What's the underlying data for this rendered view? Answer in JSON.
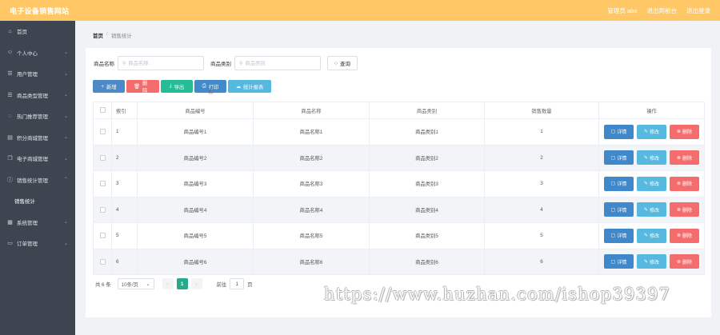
{
  "topbar": {
    "site_title": "电子设备销售网站",
    "user_label": "管理员 abo",
    "exit_label": "退出到前台",
    "logout_label": "退出登录"
  },
  "sidebar": {
    "items": [
      {
        "label": "首页",
        "icon": "home-icon",
        "expandable": false
      },
      {
        "label": "个人中心",
        "icon": "user-icon",
        "expandable": true
      },
      {
        "label": "用户管理",
        "icon": "list-icon",
        "expandable": true
      },
      {
        "label": "商品类型管理",
        "icon": "list-icon",
        "expandable": true
      },
      {
        "label": "热门推荐管理",
        "icon": "hot-icon",
        "expandable": true
      },
      {
        "label": "积分商城管理",
        "icon": "store-icon",
        "expandable": true
      },
      {
        "label": "电子商城管理",
        "icon": "copy-icon",
        "expandable": true
      },
      {
        "label": "销售统计管理",
        "icon": "info-icon",
        "expandable": true
      },
      {
        "label": "销售统计",
        "icon": "",
        "expandable": false,
        "sub": true
      },
      {
        "label": "系统管理",
        "icon": "chart-icon",
        "expandable": true
      },
      {
        "label": "订单管理",
        "icon": "order-icon",
        "expandable": true
      }
    ]
  },
  "breadcrumb": {
    "home": "首页",
    "separator": "/",
    "current": "销售统计"
  },
  "search": {
    "name_label": "商品名称",
    "name_placeholder": "商品名称",
    "type_label": "商品类别",
    "type_placeholder": "商品类别",
    "query_label": "查询"
  },
  "toolbar": {
    "add_label": "新增",
    "delete_label": "删除",
    "export_label": "导出",
    "print_label": "打印",
    "stats_label": "统计报表"
  },
  "table": {
    "headers": [
      "",
      "索引",
      "商品编号",
      "商品名称",
      "商品类别",
      "销售数量",
      "操作"
    ],
    "rows": [
      {
        "index": "1",
        "code": "商品编号1",
        "name": "商品名称1",
        "type": "商品类别1",
        "qty": "1"
      },
      {
        "index": "2",
        "code": "商品编号2",
        "name": "商品名称2",
        "type": "商品类别2",
        "qty": "2"
      },
      {
        "index": "3",
        "code": "商品编号3",
        "name": "商品名称3",
        "type": "商品类别3",
        "qty": "3"
      },
      {
        "index": "4",
        "code": "商品编号4",
        "name": "商品名称4",
        "type": "商品类别4",
        "qty": "4"
      },
      {
        "index": "5",
        "code": "商品编号5",
        "name": "商品名称5",
        "type": "商品类别5",
        "qty": "5"
      },
      {
        "index": "6",
        "code": "商品编号6",
        "name": "商品名称6",
        "type": "商品类别6",
        "qty": "6"
      }
    ],
    "row_actions": {
      "detail_label": "详情",
      "edit_label": "修改",
      "delete_label": "删除"
    }
  },
  "pagination": {
    "total": "共 6 条",
    "page_size": "10条/页",
    "current_page": "1",
    "goto_prefix": "前往",
    "goto_value": "1",
    "goto_suffix": "页"
  },
  "watermark": "https://www.huzhan.com/ishop39397",
  "colors": {
    "topbar": "#ffc766",
    "sidebar": "#3d4650",
    "primary": "#3f88cb",
    "danger": "#f56c6c",
    "success": "#26bc97",
    "info": "#57b9df"
  }
}
